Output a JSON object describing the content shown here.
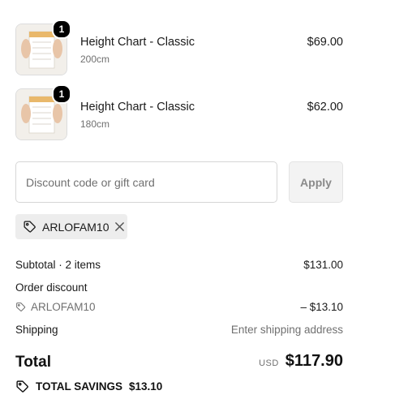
{
  "line_items": [
    {
      "name": "Height Chart - Classic",
      "variant": "200cm",
      "price": "$69.00",
      "quantity": "1"
    },
    {
      "name": "Height Chart - Classic",
      "variant": "180cm",
      "price": "$62.00",
      "quantity": "1"
    }
  ],
  "discount": {
    "placeholder": "Discount code or gift card",
    "apply_label": "Apply",
    "applied_code": "ARLOFAM10"
  },
  "summary": {
    "subtotal_label": "Subtotal · 2 items",
    "subtotal_value": "$131.00",
    "order_discount_label": "Order discount",
    "discount_code": "ARLOFAM10",
    "discount_value": "– $13.10",
    "shipping_label": "Shipping",
    "shipping_value": "Enter shipping address",
    "total_label": "Total",
    "currency": "USD",
    "total_value": "$117.90",
    "savings_label": "TOTAL SAVINGS",
    "savings_value": "$13.10"
  },
  "icons": {
    "tag": "tag-icon",
    "close": "close-icon"
  },
  "colors": {
    "badge": "#000000",
    "chip_bg": "#ededed",
    "muted": "#707070"
  }
}
